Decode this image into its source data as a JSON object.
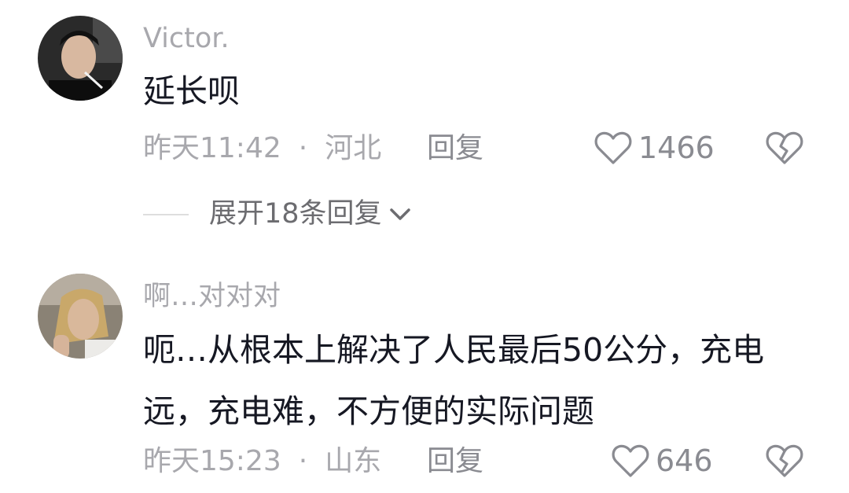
{
  "comments": [
    {
      "username": "Victor.",
      "text": "延长呗",
      "time": "昨天11:42",
      "separator": "·",
      "location": "河北",
      "reply_label": "回复",
      "likes": "1466",
      "expand_label": "展开18条回复"
    },
    {
      "username": "啊…对对对",
      "text": "呃…从根本上解决了人民最后50公分，充电远，充电难，不方便的实际问题",
      "time": "昨天15:23",
      "separator": "·",
      "location": "山东",
      "reply_label": "回复",
      "likes": "646"
    }
  ],
  "icons": {
    "like": "heart-outline-icon",
    "dislike": "broken-heart-icon",
    "expand": "chevron-down-icon"
  },
  "colors": {
    "meta_gray": "#a8a8ad",
    "icon_gray": "#8a8b91",
    "text_dark": "#161823"
  }
}
